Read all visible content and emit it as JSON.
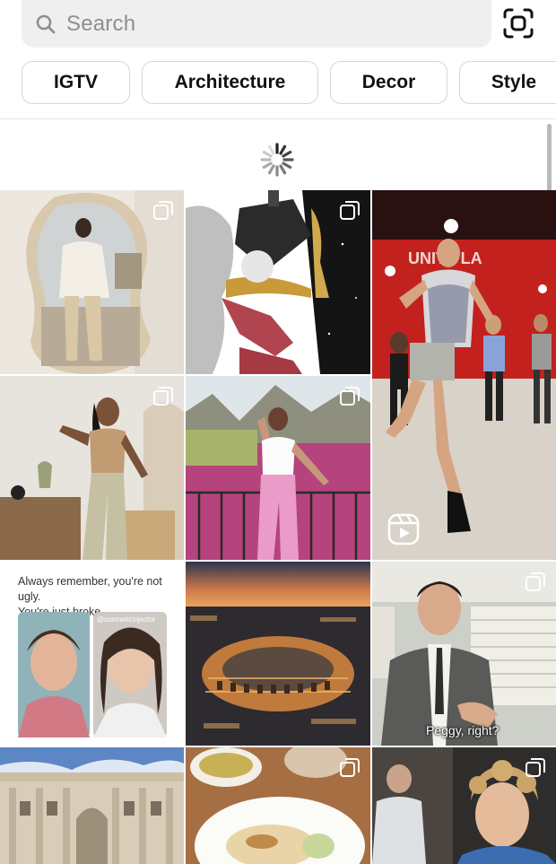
{
  "search": {
    "placeholder": "Search"
  },
  "chips": [
    "IGTV",
    "Architecture",
    "Decor",
    "Style"
  ],
  "tiles": {
    "quote_line1": "Always remember, you're not ugly.",
    "quote_line2": "You're just broke.",
    "quote_handle": "@cosmeticinjector",
    "peggy_caption": "Peggy, right?",
    "dance_sign": "UNITY LA"
  },
  "icons": {
    "search": "search-icon",
    "scan": "scan-icon",
    "spinner": "loading-spinner-icon",
    "multi": "multiple-photos-icon",
    "reel": "reels-icon"
  },
  "colors": {
    "search_bg": "#efefef",
    "chip_border": "#d6d6d6",
    "placeholder": "#8e8e8e"
  }
}
